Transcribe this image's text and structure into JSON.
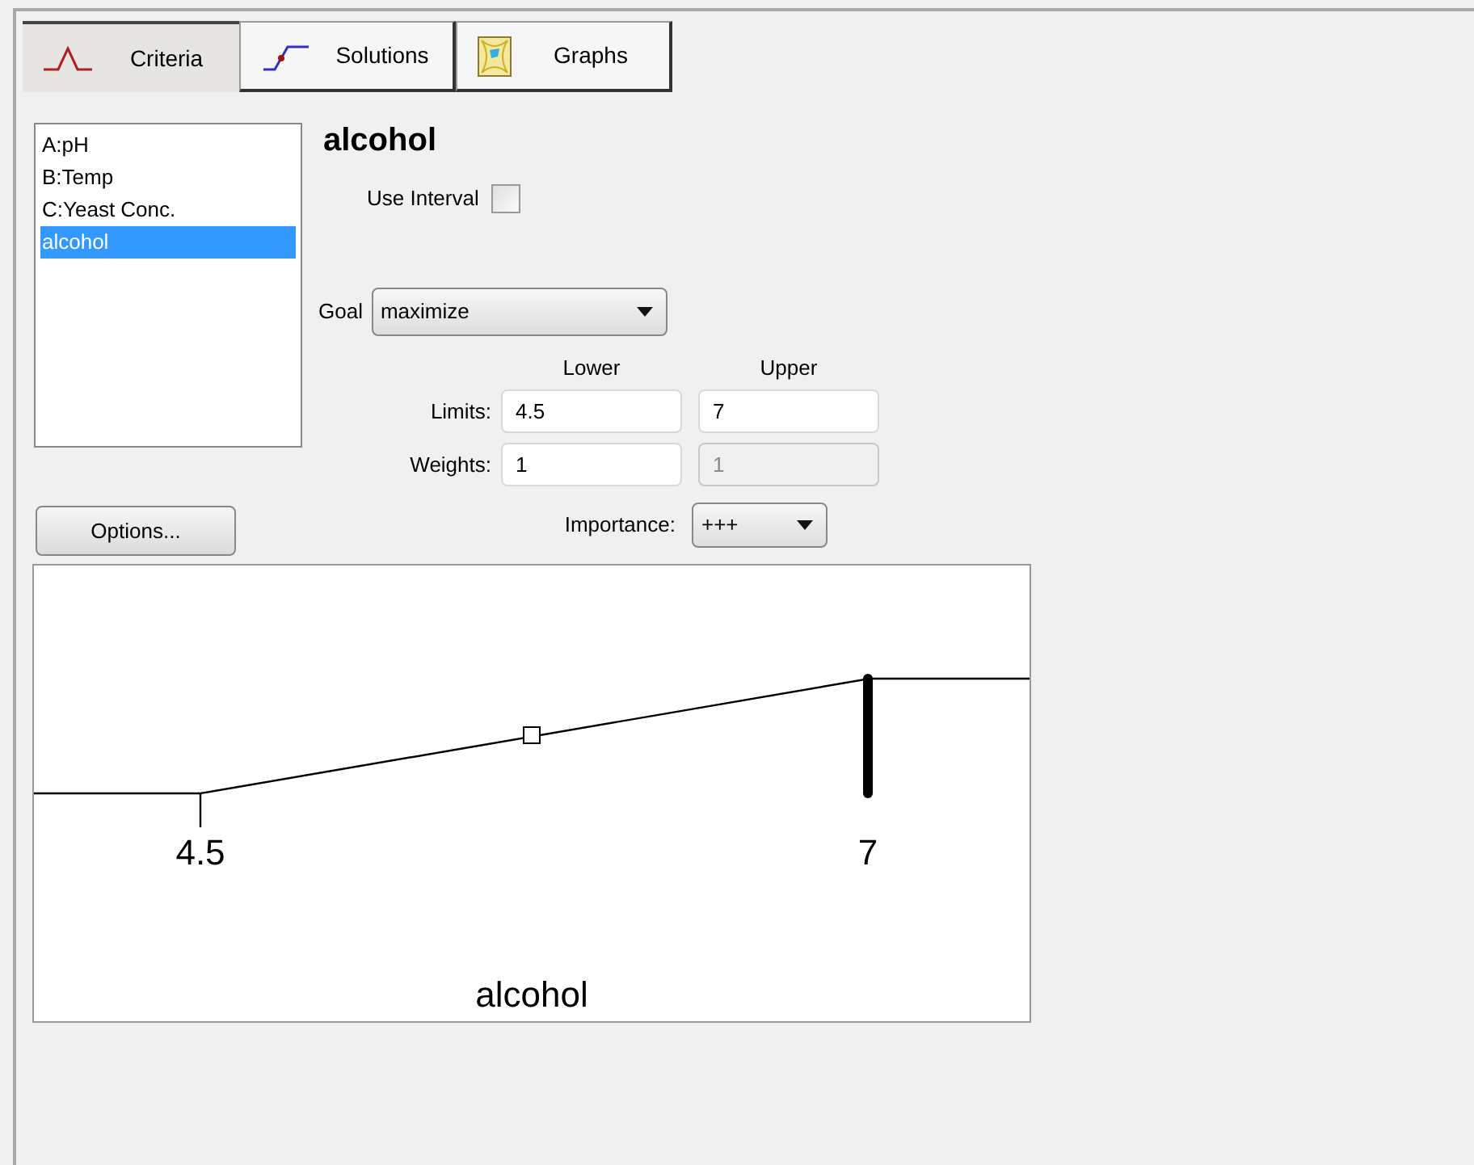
{
  "tabs": [
    {
      "label": "Criteria",
      "selected": true,
      "kind": "peak"
    },
    {
      "label": "Solutions",
      "selected": false,
      "kind": "step"
    },
    {
      "label": "Graphs",
      "selected": false,
      "kind": "graph"
    }
  ],
  "criteria_list": [
    {
      "label": "A:pH",
      "selected": false
    },
    {
      "label": "B:Temp",
      "selected": false
    },
    {
      "label": "C:Yeast Conc.",
      "selected": false
    },
    {
      "label": "alcohol",
      "selected": true
    }
  ],
  "options_button": "Options...",
  "criterion": {
    "title": "alcohol",
    "use_interval": {
      "label": "Use Interval",
      "checked": false
    },
    "goal": {
      "label": "Goal",
      "value": "maximize"
    },
    "columns": [
      "Lower",
      "Upper"
    ],
    "limits": {
      "label": "Limits:",
      "lower": "4.5",
      "upper": "7"
    },
    "weights": {
      "label": "Weights:",
      "lower": "1",
      "upper": "1",
      "upper_disabled": true
    },
    "importance": {
      "label": "Importance:",
      "value": "+++"
    }
  },
  "graph": {
    "tick_labels": [
      "4.5",
      "7"
    ],
    "axis_label": "alcohol"
  }
}
